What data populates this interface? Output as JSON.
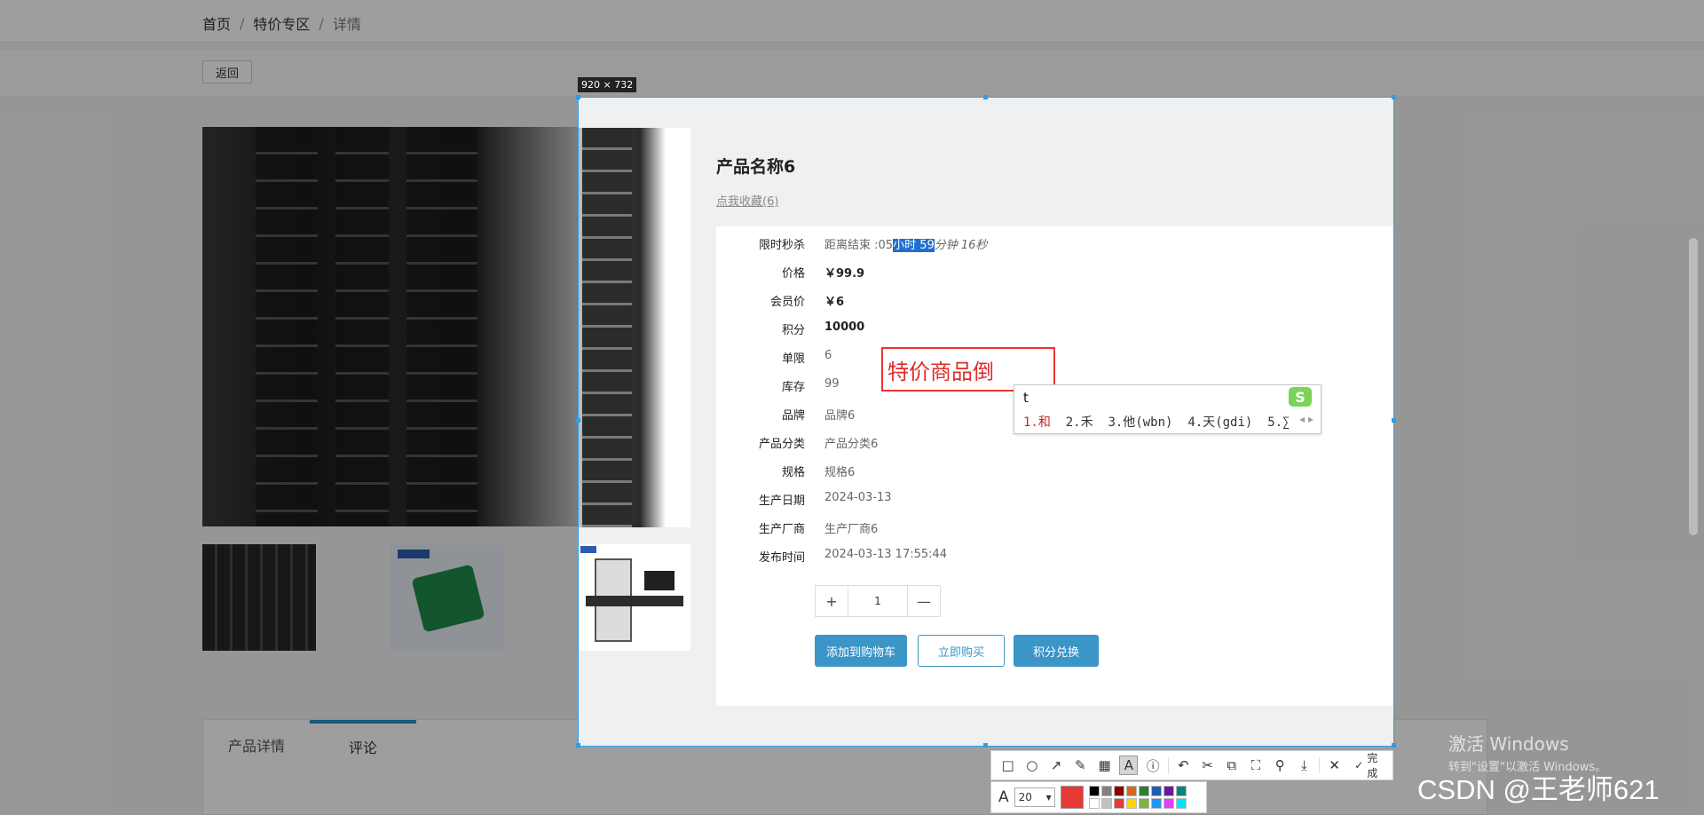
{
  "breadcrumb": {
    "home": "首页",
    "section": "特价专区",
    "current": "详情",
    "sep": "/"
  },
  "actions": {
    "back_label": "返回"
  },
  "tabs": [
    {
      "label": "产品详情"
    },
    {
      "label": "评论"
    }
  ],
  "capture": {
    "size_label": "920 × 732"
  },
  "product": {
    "title": "产品名称6",
    "favorite_link": "点我收藏(6)",
    "fields": [
      {
        "label": "限时秒杀",
        "value_pre": "距离结束 :05",
        "value_hl": "小时 59",
        "value_post": "分钟 16秒"
      },
      {
        "label": "价格",
        "value": "￥99.9"
      },
      {
        "label": "会员价",
        "value": "￥6"
      },
      {
        "label": "积分",
        "value": "10000"
      },
      {
        "label": "单限",
        "value": "6"
      },
      {
        "label": "库存",
        "value": "99"
      },
      {
        "label": "品牌",
        "value": "品牌6"
      },
      {
        "label": "产品分类",
        "value": "产品分类6"
      },
      {
        "label": "规格",
        "value": "规格6"
      },
      {
        "label": "生产日期",
        "value": "2024-03-13"
      },
      {
        "label": "生产厂商",
        "value": "生产厂商6"
      },
      {
        "label": "发布时间",
        "value": "2024-03-13 17:55:44"
      }
    ],
    "quantity": {
      "plus": "+",
      "value": "1",
      "minus": "—"
    },
    "buttons": {
      "add_to_cart": "添加到购物车",
      "buy_now": "立即购买",
      "redeem_points": "积分兑换"
    }
  },
  "annotation": {
    "text": "特价商品倒"
  },
  "ime": {
    "input": "t",
    "logo": "S",
    "candidates": [
      "1.和",
      "2.禾",
      "3.他(wbn)",
      "4.天(gdi)",
      "5.∑"
    ]
  },
  "toolbar": {
    "done_label": "完成",
    "font_size": "20",
    "current_color": "#e53935",
    "palette": [
      "#000000",
      "#808080",
      "#8b0000",
      "#d2691e",
      "#2e7d32",
      "#1f5fa8",
      "#6a1b9a",
      "#00897b",
      "#ffffff",
      "#c0c0c0",
      "#e53935",
      "#ffd600",
      "#7cb342",
      "#2196f3",
      "#e040fb",
      "#00e5ff"
    ]
  },
  "os": {
    "activate_title": "激活 Windows",
    "activate_sub": "转到\"设置\"以激活 Windows。"
  },
  "watermark": "CSDN @王老师621"
}
